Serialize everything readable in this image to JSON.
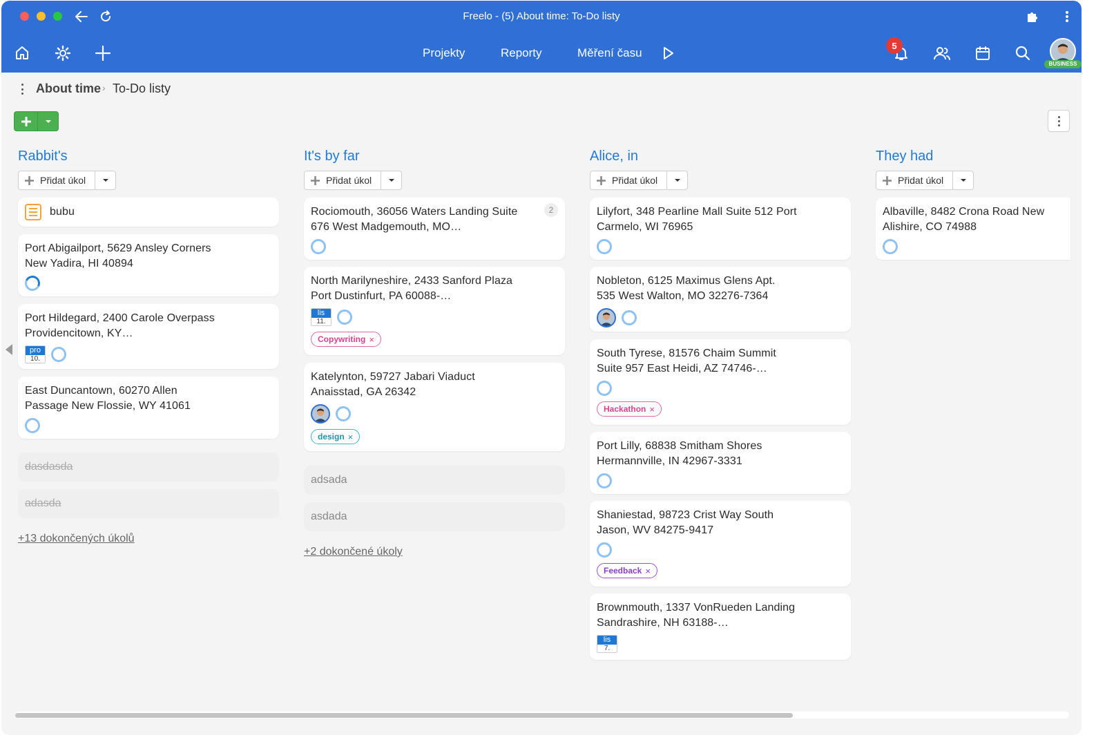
{
  "window": {
    "title": "Freelo - (5) About time: To-Do listy"
  },
  "nav": {
    "links": [
      "Projekty",
      "Reporty",
      "Měření času"
    ],
    "notifications_count": "5",
    "account_badge": "BUSINESS"
  },
  "breadcrumb": {
    "project": "About time",
    "separator": ">",
    "page": "To-Do listy"
  },
  "add_task_label": "Přidat úkol",
  "columns": [
    {
      "title": "Rabbit's",
      "cards": [
        {
          "text": "bubu"
        },
        {
          "text": "Port Abigailport, 5629 Ansley Corners New Yadira, HI 40894"
        },
        {
          "text": "Port Hildegard, 2400 Carole Overpass Providencitown, KY…",
          "date_month": "pro",
          "date_day": "10."
        },
        {
          "text": "East Duncantown, 60270 Allen Passage New Flossie, WY 41061"
        }
      ],
      "done": [
        "dasdasda",
        "adasda"
      ],
      "completed_link": "+13 dokončených úkolů"
    },
    {
      "title": "It's by far",
      "cards": [
        {
          "text": "Rociomouth, 36056 Waters Landing Suite 676 West Madgemouth, MO…",
          "count": "2"
        },
        {
          "text": "North Marilyneshire, 2433 Sanford Plaza Port Dustinfurt, PA 60088-…",
          "date_month": "lis",
          "date_day": "11.",
          "tag": "Copywriting"
        },
        {
          "text": "Katelynton, 59727 Jabari Viaduct Anaisstad, GA 26342",
          "tag": "design"
        }
      ],
      "open": [
        "adsada",
        "asdada"
      ],
      "completed_link": "+2 dokončené úkoly"
    },
    {
      "title": "Alice, in",
      "cards": [
        {
          "text": "Lilyfort, 348 Pearline Mall Suite 512 Port Carmelo, WI 76965"
        },
        {
          "text": "Nobleton, 6125 Maximus Glens Apt. 535 West Walton, MO 32276-7364"
        },
        {
          "text": "South Tyrese, 81576 Chaim Summit Suite 957 East Heidi, AZ 74746-…",
          "tag": "Hackathon"
        },
        {
          "text": "Port Lilly, 68838 Smitham Shores Hermannville, IN 42967-3331"
        },
        {
          "text": "Shaniestad, 98723 Crist Way South Jason, WV 84275-9417",
          "tag": "Feedback"
        },
        {
          "text": "Brownmouth, 1337 VonRueden Landing Sandrashire, NH 63188-…",
          "date_month": "lis",
          "date_day": "7."
        }
      ]
    },
    {
      "title": "They had",
      "cards": [
        {
          "text": "Albaville, 8482 Crona Road New Alishire, CO 74988"
        }
      ]
    }
  ],
  "colors": {
    "brand_blue": "#2f6fd6",
    "column_title": "#1f7ad9",
    "add_green": "#4caf50"
  }
}
